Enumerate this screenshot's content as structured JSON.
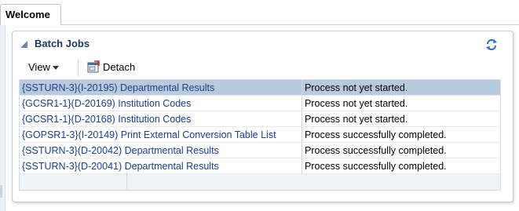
{
  "tabs": [
    {
      "label": "Welcome"
    }
  ],
  "panel": {
    "title": "Batch Jobs",
    "toolbar": {
      "view_label": "View",
      "detach_label": "Detach"
    },
    "icons": {
      "collapse": "collapse-triangle-icon",
      "refresh": "refresh-icon",
      "detach": "detach-icon"
    }
  },
  "jobs": [
    {
      "name": "{SSTURN-3}(I-20195) Departmental Results",
      "status": "Process not yet started.",
      "selected": true
    },
    {
      "name": "{GCSR1-1}(D-20169) Institution Codes",
      "status": "Process not yet started."
    },
    {
      "name": "{GCSR1-1}(D-20168) Institution Codes",
      "status": "Process not yet started."
    },
    {
      "name": "{GOPSR1-3}(I-20149) Print External Conversion Table List",
      "status": "Process successfully completed."
    },
    {
      "name": "{SSTURN-3}(D-20042) Departmental Results",
      "status": "Process successfully completed."
    },
    {
      "name": "{SSTURN-3}(D-20041) Departmental Results",
      "status": "Process successfully completed."
    }
  ],
  "colors": {
    "link": "#1a3f8c",
    "selected_row": "#b6cbe0",
    "title": "#1b3654"
  }
}
